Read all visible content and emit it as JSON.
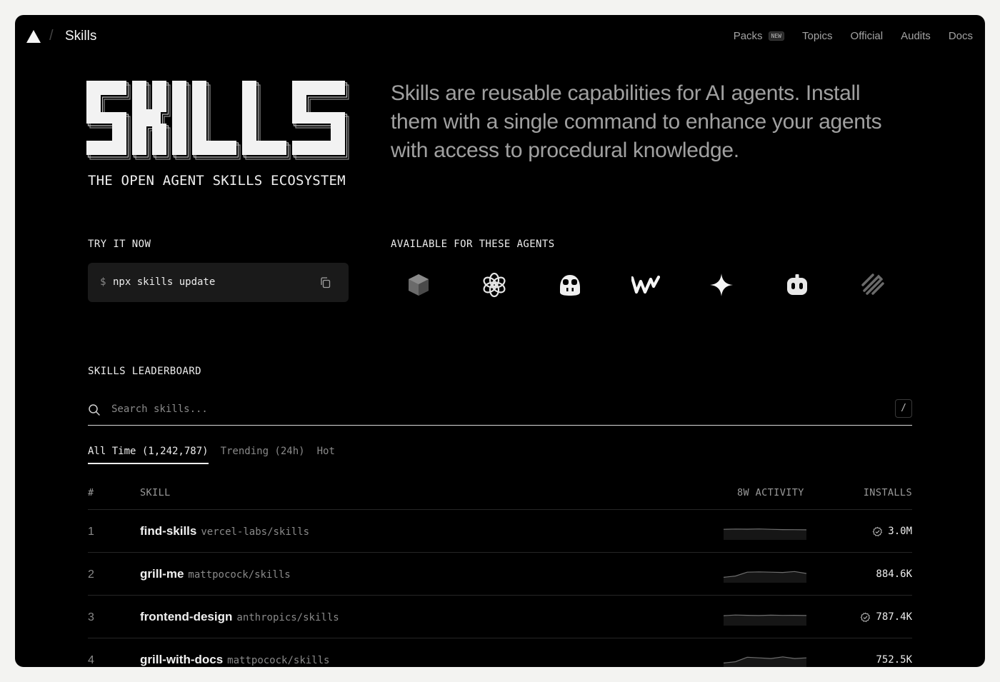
{
  "nav": {
    "title": "Skills",
    "separator": "/",
    "links": [
      {
        "label": "Packs",
        "badge": "NEW"
      },
      {
        "label": "Topics"
      },
      {
        "label": "Official"
      },
      {
        "label": "Audits"
      },
      {
        "label": "Docs"
      }
    ]
  },
  "hero": {
    "logo_text": "SKILLS",
    "subtitle": "THE OPEN AGENT SKILLS ECOSYSTEM",
    "description": "Skills are reusable capabilities for AI agents. Install them with a single command to enhance your agents with access to procedural knowledge."
  },
  "try_it": {
    "label": "TRY IT NOW",
    "prompt": "$",
    "command": "npx skills update"
  },
  "agents": {
    "label": "AVAILABLE FOR THESE AGENTS",
    "icons": [
      "cube-agent-icon",
      "openai-icon",
      "copilot-icon",
      "windsurf-icon",
      "gemini-sparkle-icon",
      "robot-agent-icon",
      "stripes-agent-icon"
    ]
  },
  "leaderboard": {
    "label": "SKILLS LEADERBOARD",
    "search_placeholder": "Search skills...",
    "shortcut": "/",
    "tabs": [
      {
        "label": "All Time (1,242,787)",
        "active": true
      },
      {
        "label": "Trending (24h)",
        "active": false
      },
      {
        "label": "Hot",
        "active": false
      }
    ],
    "columns": {
      "rank": "#",
      "skill": "SKILL",
      "activity": "8W ACTIVITY",
      "installs": "INSTALLS"
    },
    "rows": [
      {
        "rank": "1",
        "name": "find-skills",
        "repo": "vercel-labs/skills",
        "installs": "3.0M",
        "verified": true,
        "activity": [
          6,
          6.2,
          6.1,
          6.3,
          6,
          5.8,
          5.7,
          5.6
        ]
      },
      {
        "rank": "2",
        "name": "grill-me",
        "repo": "mattpocock/skills",
        "installs": "884.6K",
        "verified": false,
        "activity": [
          2,
          3,
          6,
          6.2,
          6,
          5.8,
          6.5,
          5
        ]
      },
      {
        "rank": "3",
        "name": "frontend-design",
        "repo": "anthropics/skills",
        "installs": "787.4K",
        "verified": true,
        "activity": [
          5.5,
          6,
          5.8,
          5.6,
          5.9,
          5.7,
          5.8,
          5.6
        ]
      },
      {
        "rank": "4",
        "name": "grill-with-docs",
        "repo": "mattpocock/skills",
        "installs": "752.5K",
        "verified": false,
        "activity": [
          2,
          3,
          6.5,
          6,
          5.5,
          6.8,
          5.5,
          6
        ]
      }
    ]
  }
}
